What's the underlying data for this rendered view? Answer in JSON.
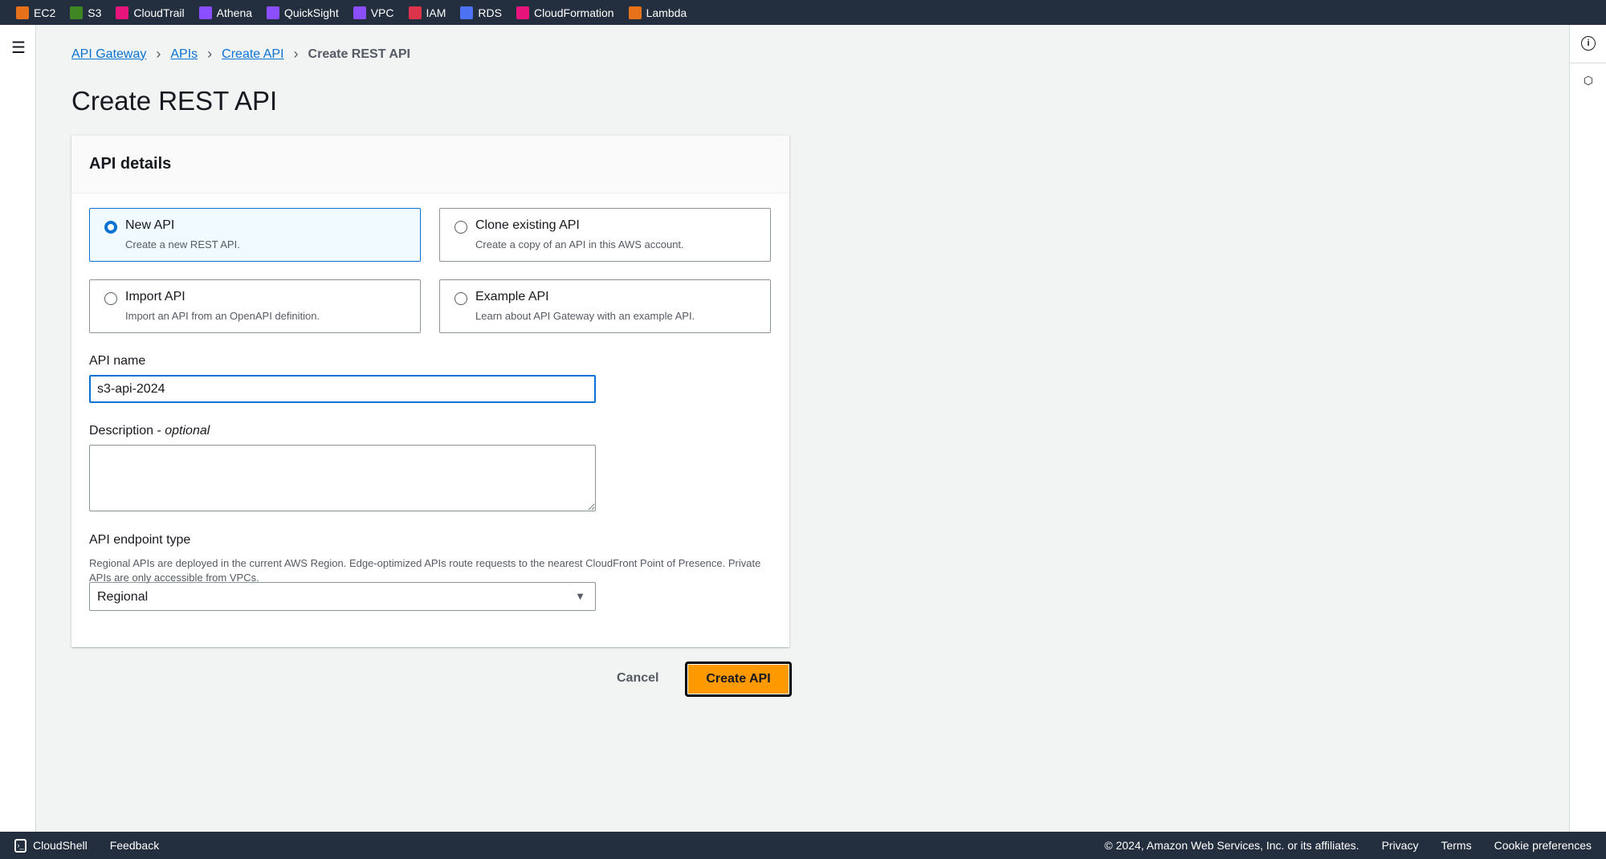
{
  "topbar": {
    "services": [
      {
        "label": "EC2",
        "color": "#e7711b"
      },
      {
        "label": "S3",
        "color": "#3f8624"
      },
      {
        "label": "CloudTrail",
        "color": "#e7157b"
      },
      {
        "label": "Athena",
        "color": "#8c4fff"
      },
      {
        "label": "QuickSight",
        "color": "#8c4fff"
      },
      {
        "label": "VPC",
        "color": "#8c4fff"
      },
      {
        "label": "IAM",
        "color": "#dd344c"
      },
      {
        "label": "RDS",
        "color": "#4d72f3"
      },
      {
        "label": "CloudFormation",
        "color": "#e7157b"
      },
      {
        "label": "Lambda",
        "color": "#e7711b"
      }
    ]
  },
  "breadcrumb": [
    "API Gateway",
    "APIs",
    "Create API",
    "Create REST API"
  ],
  "page_title": "Create REST API",
  "card": {
    "title": "API details",
    "options": [
      {
        "title": "New API",
        "desc": "Create a new REST API.",
        "selected": true
      },
      {
        "title": "Clone existing API",
        "desc": "Create a copy of an API in this AWS account.",
        "selected": false
      },
      {
        "title": "Import API",
        "desc": "Import an API from an OpenAPI definition.",
        "selected": false
      },
      {
        "title": "Example API",
        "desc": "Learn about API Gateway with an example API.",
        "selected": false
      }
    ],
    "api_name_label": "API name",
    "api_name_value": "s3-api-2024",
    "description_label": "Description",
    "description_optional": "optional",
    "description_sep": " - ",
    "endpoint_label": "API endpoint type",
    "endpoint_help": "Regional APIs are deployed in the current AWS Region. Edge-optimized APIs route requests to the nearest CloudFront Point of Presence. Private APIs are only accessible from VPCs.",
    "endpoint_value": "Regional"
  },
  "actions": {
    "cancel": "Cancel",
    "create": "Create API"
  },
  "footer": {
    "cloudshell": "CloudShell",
    "feedback": "Feedback",
    "copyright": "© 2024, Amazon Web Services, Inc. or its affiliates.",
    "privacy": "Privacy",
    "terms": "Terms",
    "cookies": "Cookie preferences"
  },
  "accent": "#0972d3",
  "primary_button": "#ff9900"
}
